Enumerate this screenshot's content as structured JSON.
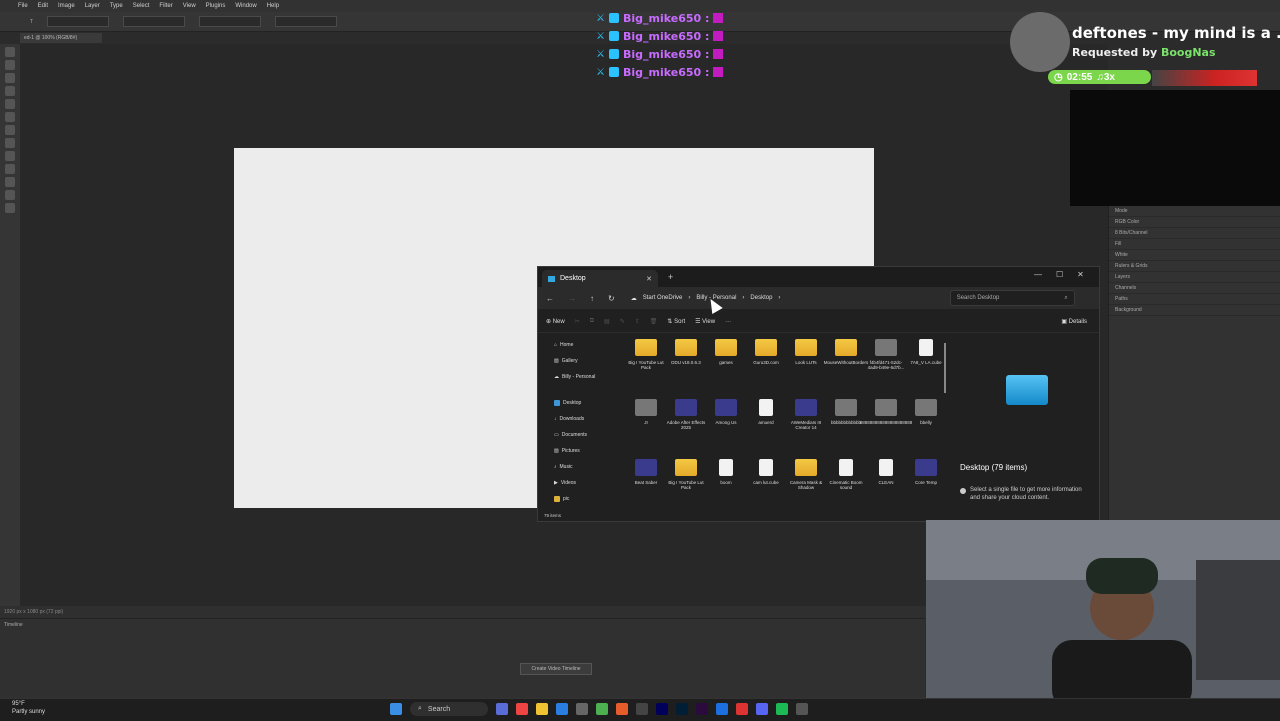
{
  "photoshop": {
    "menu": [
      "File",
      "Edit",
      "Image",
      "Layer",
      "Type",
      "Select",
      "Filter",
      "View",
      "Plugins",
      "Window",
      "Help"
    ],
    "doc_tab": "ed-1 @ 100% (RGB/8#)",
    "status": "1920 px x 1080 px (72 ppi)",
    "timeline_label": "Timeline",
    "timeline_button": "Create Video Timeline",
    "right_panel_rows": [
      "Mode",
      "RGB Color",
      "8 Bits/Channel",
      "Fill",
      "White",
      "Rulers & Grids",
      "Layers",
      "Channels",
      "Paths",
      "Background"
    ]
  },
  "chat": [
    {
      "user": "Big_mike650 :"
    },
    {
      "user": "Big_mike650 :"
    },
    {
      "user": "Big_mike650 :"
    },
    {
      "user": "Big_mike650 :"
    }
  ],
  "now_playing": {
    "title": "deftones - my mind is a ...",
    "requested_prefix": "Requested by",
    "requested_user": "BoogNas",
    "time": "02:55",
    "plays": "♫3x"
  },
  "explorer": {
    "tab_title": "Desktop",
    "breadcrumb": [
      "Start OneDrive",
      "Billy - Personal",
      "Desktop"
    ],
    "search_placeholder": "Search Desktop",
    "cmd": {
      "new": "New",
      "sort": "Sort",
      "view": "View",
      "more": "···",
      "details": "Details"
    },
    "nav": [
      "Home",
      "Gallery",
      "Billy - Personal",
      "Desktop",
      "Downloads",
      "Documents",
      "Pictures",
      "Music",
      "Videos",
      "pic"
    ],
    "files": [
      {
        "name": "Big I YouTube Lut Pack",
        "kind": "folder"
      },
      {
        "name": "DDU v18.0.6.3",
        "kind": "folder"
      },
      {
        "name": "games",
        "kind": "folder"
      },
      {
        "name": "Guru3D.com",
        "kind": "folder"
      },
      {
        "name": "Look LUTs",
        "kind": "folder"
      },
      {
        "name": "MouseWithoutBorders",
        "kind": "folder"
      },
      {
        "name": "f4b4fd471-52dc-4ad9-b49e-6d7b...",
        "kind": "img"
      },
      {
        "name": "7A8_V LA.cube",
        "kind": "doc"
      },
      {
        "name": "JI",
        "kind": "img"
      },
      {
        "name": "Adobe After Effects 2025",
        "kind": "app"
      },
      {
        "name": "Among Us",
        "kind": "app"
      },
      {
        "name": "amuerd",
        "kind": "doc"
      },
      {
        "name": "AWeMediaIs III Creator 14",
        "kind": "app"
      },
      {
        "name": "bbbbbbbbbbbb",
        "kind": "img"
      },
      {
        "name": "888888888888888888888",
        "kind": "img"
      },
      {
        "name": "bbelly",
        "kind": "img"
      },
      {
        "name": "Beat Saber",
        "kind": "app"
      },
      {
        "name": "Big I YouTube Lut Pack",
        "kind": "folder"
      },
      {
        "name": "boom",
        "kind": "doc"
      },
      {
        "name": "cam lut.cube",
        "kind": "doc"
      },
      {
        "name": "Camera Mask & Shadow",
        "kind": "folder"
      },
      {
        "name": "Cinematic Boom sound",
        "kind": "doc"
      },
      {
        "name": "CLEAN",
        "kind": "doc"
      },
      {
        "name": "Core Temp",
        "kind": "app"
      }
    ],
    "preview": {
      "title": "Desktop (79 items)",
      "info": "Select a single file to get more information and share your cloud content."
    },
    "item_count": "79 items"
  },
  "taskbar": {
    "weather_temp": "95°F",
    "weather_desc": "Partly sunny",
    "search": "Search"
  }
}
